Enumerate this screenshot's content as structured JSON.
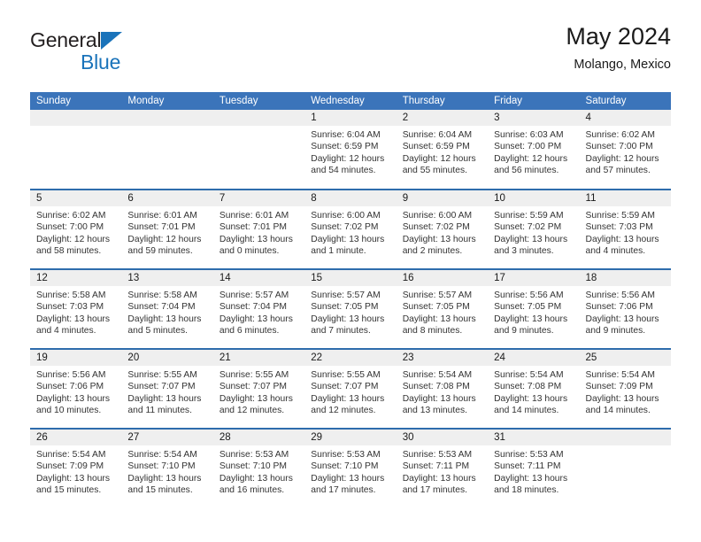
{
  "logo": {
    "word1": "General",
    "word2": "Blue",
    "triangle_color": "#1a73ba",
    "text_color": "#231f20"
  },
  "header": {
    "title": "May 2024",
    "subtitle": "Molango, Mexico"
  },
  "theme": {
    "header_blue": "#3b74ba",
    "row_divider_blue": "#2e6cac",
    "daynum_band": "#efefef"
  },
  "calendar": {
    "day_headers": [
      "Sunday",
      "Monday",
      "Tuesday",
      "Wednesday",
      "Thursday",
      "Friday",
      "Saturday"
    ],
    "weeks": [
      [
        {
          "day": "",
          "lines": []
        },
        {
          "day": "",
          "lines": []
        },
        {
          "day": "",
          "lines": []
        },
        {
          "day": "1",
          "lines": [
            "Sunrise: 6:04 AM",
            "Sunset: 6:59 PM",
            "Daylight: 12 hours",
            "and 54 minutes."
          ]
        },
        {
          "day": "2",
          "lines": [
            "Sunrise: 6:04 AM",
            "Sunset: 6:59 PM",
            "Daylight: 12 hours",
            "and 55 minutes."
          ]
        },
        {
          "day": "3",
          "lines": [
            "Sunrise: 6:03 AM",
            "Sunset: 7:00 PM",
            "Daylight: 12 hours",
            "and 56 minutes."
          ]
        },
        {
          "day": "4",
          "lines": [
            "Sunrise: 6:02 AM",
            "Sunset: 7:00 PM",
            "Daylight: 12 hours",
            "and 57 minutes."
          ]
        }
      ],
      [
        {
          "day": "5",
          "lines": [
            "Sunrise: 6:02 AM",
            "Sunset: 7:00 PM",
            "Daylight: 12 hours",
            "and 58 minutes."
          ]
        },
        {
          "day": "6",
          "lines": [
            "Sunrise: 6:01 AM",
            "Sunset: 7:01 PM",
            "Daylight: 12 hours",
            "and 59 minutes."
          ]
        },
        {
          "day": "7",
          "lines": [
            "Sunrise: 6:01 AM",
            "Sunset: 7:01 PM",
            "Daylight: 13 hours",
            "and 0 minutes."
          ]
        },
        {
          "day": "8",
          "lines": [
            "Sunrise: 6:00 AM",
            "Sunset: 7:02 PM",
            "Daylight: 13 hours",
            "and 1 minute."
          ]
        },
        {
          "day": "9",
          "lines": [
            "Sunrise: 6:00 AM",
            "Sunset: 7:02 PM",
            "Daylight: 13 hours",
            "and 2 minutes."
          ]
        },
        {
          "day": "10",
          "lines": [
            "Sunrise: 5:59 AM",
            "Sunset: 7:02 PM",
            "Daylight: 13 hours",
            "and 3 minutes."
          ]
        },
        {
          "day": "11",
          "lines": [
            "Sunrise: 5:59 AM",
            "Sunset: 7:03 PM",
            "Daylight: 13 hours",
            "and 4 minutes."
          ]
        }
      ],
      [
        {
          "day": "12",
          "lines": [
            "Sunrise: 5:58 AM",
            "Sunset: 7:03 PM",
            "Daylight: 13 hours",
            "and 4 minutes."
          ]
        },
        {
          "day": "13",
          "lines": [
            "Sunrise: 5:58 AM",
            "Sunset: 7:04 PM",
            "Daylight: 13 hours",
            "and 5 minutes."
          ]
        },
        {
          "day": "14",
          "lines": [
            "Sunrise: 5:57 AM",
            "Sunset: 7:04 PM",
            "Daylight: 13 hours",
            "and 6 minutes."
          ]
        },
        {
          "day": "15",
          "lines": [
            "Sunrise: 5:57 AM",
            "Sunset: 7:05 PM",
            "Daylight: 13 hours",
            "and 7 minutes."
          ]
        },
        {
          "day": "16",
          "lines": [
            "Sunrise: 5:57 AM",
            "Sunset: 7:05 PM",
            "Daylight: 13 hours",
            "and 8 minutes."
          ]
        },
        {
          "day": "17",
          "lines": [
            "Sunrise: 5:56 AM",
            "Sunset: 7:05 PM",
            "Daylight: 13 hours",
            "and 9 minutes."
          ]
        },
        {
          "day": "18",
          "lines": [
            "Sunrise: 5:56 AM",
            "Sunset: 7:06 PM",
            "Daylight: 13 hours",
            "and 9 minutes."
          ]
        }
      ],
      [
        {
          "day": "19",
          "lines": [
            "Sunrise: 5:56 AM",
            "Sunset: 7:06 PM",
            "Daylight: 13 hours",
            "and 10 minutes."
          ]
        },
        {
          "day": "20",
          "lines": [
            "Sunrise: 5:55 AM",
            "Sunset: 7:07 PM",
            "Daylight: 13 hours",
            "and 11 minutes."
          ]
        },
        {
          "day": "21",
          "lines": [
            "Sunrise: 5:55 AM",
            "Sunset: 7:07 PM",
            "Daylight: 13 hours",
            "and 12 minutes."
          ]
        },
        {
          "day": "22",
          "lines": [
            "Sunrise: 5:55 AM",
            "Sunset: 7:07 PM",
            "Daylight: 13 hours",
            "and 12 minutes."
          ]
        },
        {
          "day": "23",
          "lines": [
            "Sunrise: 5:54 AM",
            "Sunset: 7:08 PM",
            "Daylight: 13 hours",
            "and 13 minutes."
          ]
        },
        {
          "day": "24",
          "lines": [
            "Sunrise: 5:54 AM",
            "Sunset: 7:08 PM",
            "Daylight: 13 hours",
            "and 14 minutes."
          ]
        },
        {
          "day": "25",
          "lines": [
            "Sunrise: 5:54 AM",
            "Sunset: 7:09 PM",
            "Daylight: 13 hours",
            "and 14 minutes."
          ]
        }
      ],
      [
        {
          "day": "26",
          "lines": [
            "Sunrise: 5:54 AM",
            "Sunset: 7:09 PM",
            "Daylight: 13 hours",
            "and 15 minutes."
          ]
        },
        {
          "day": "27",
          "lines": [
            "Sunrise: 5:54 AM",
            "Sunset: 7:10 PM",
            "Daylight: 13 hours",
            "and 15 minutes."
          ]
        },
        {
          "day": "28",
          "lines": [
            "Sunrise: 5:53 AM",
            "Sunset: 7:10 PM",
            "Daylight: 13 hours",
            "and 16 minutes."
          ]
        },
        {
          "day": "29",
          "lines": [
            "Sunrise: 5:53 AM",
            "Sunset: 7:10 PM",
            "Daylight: 13 hours",
            "and 17 minutes."
          ]
        },
        {
          "day": "30",
          "lines": [
            "Sunrise: 5:53 AM",
            "Sunset: 7:11 PM",
            "Daylight: 13 hours",
            "and 17 minutes."
          ]
        },
        {
          "day": "31",
          "lines": [
            "Sunrise: 5:53 AM",
            "Sunset: 7:11 PM",
            "Daylight: 13 hours",
            "and 18 minutes."
          ]
        },
        {
          "day": "",
          "lines": []
        }
      ]
    ]
  }
}
